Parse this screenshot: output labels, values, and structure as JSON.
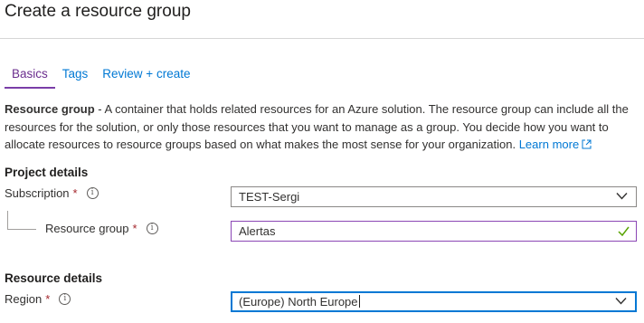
{
  "page": {
    "title": "Create a resource group"
  },
  "tabs": [
    {
      "label": "Basics",
      "active": true
    },
    {
      "label": "Tags",
      "active": false
    },
    {
      "label": "Review + create",
      "active": false
    }
  ],
  "description": {
    "term": "Resource group",
    "text": " - A container that holds related resources for an Azure solution. The resource group can include all the resources for the solution, or only those resources that you want to manage as a group. You decide how you want to allocate resources to resource groups based on what makes the most sense for your organization. ",
    "link_label": "Learn more",
    "link_icon": "external-link-icon"
  },
  "project_details": {
    "heading": "Project details",
    "subscription": {
      "label": "Subscription",
      "required_mark": "*",
      "value": "TEST-Sergi",
      "icon": "chevron-down-icon"
    },
    "resource_group": {
      "label": "Resource group",
      "required_mark": "*",
      "value": "Alertas",
      "status_icon": "checkmark-icon"
    }
  },
  "resource_details": {
    "heading": "Resource details",
    "region": {
      "label": "Region",
      "required_mark": "*",
      "value": "(Europe) North Europe",
      "icon": "chevron-down-icon"
    }
  },
  "colors": {
    "accent": "#0078d4",
    "active_tab": "#6b2e8e",
    "required": "#a4262c",
    "valid": "#57a300"
  }
}
